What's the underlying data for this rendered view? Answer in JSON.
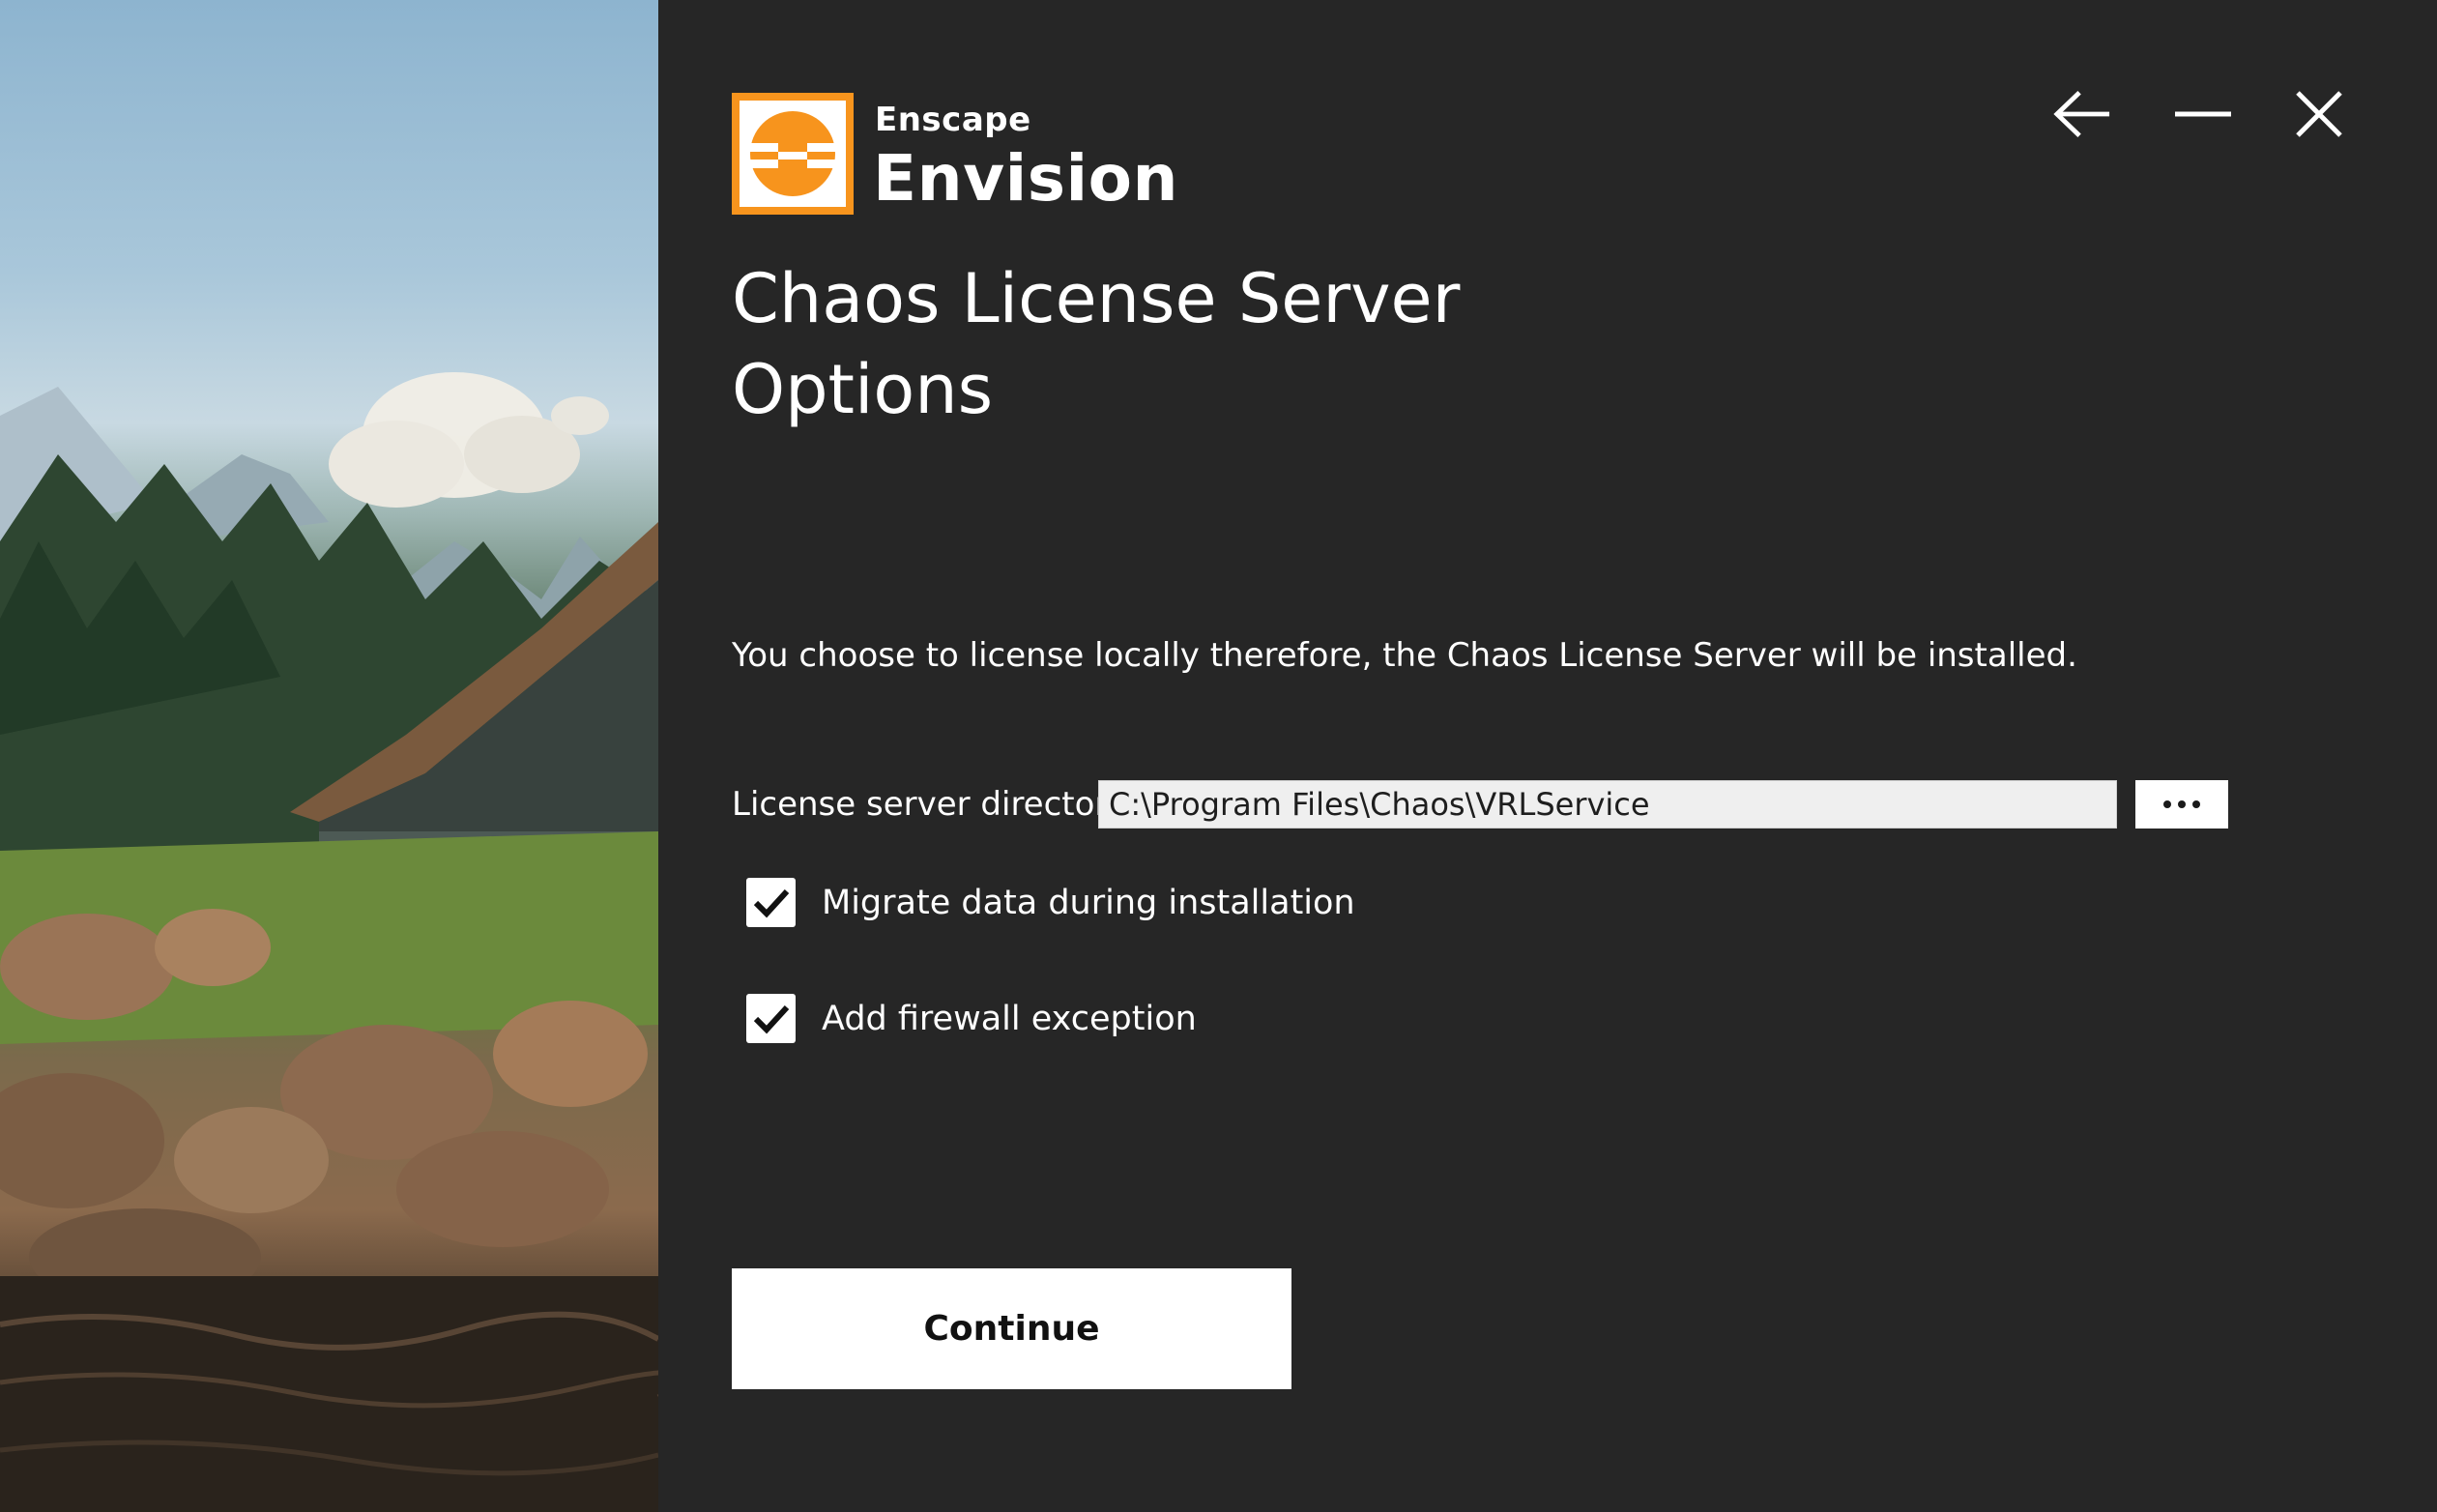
{
  "brand": {
    "small": "Enscape",
    "large": "Envision",
    "accent_color": "#f7941d"
  },
  "window_controls": {
    "back_icon": "arrow-left-icon",
    "minimize_icon": "minimize-icon",
    "close_icon": "close-icon"
  },
  "page": {
    "title_line1": "Chaos License Server",
    "title_line2": "Options",
    "info": "You choose to license locally therefore, the Chaos License Server will be installed."
  },
  "directory": {
    "label": "License server directory",
    "value": "C:\\Program Files\\Chaos\\VRLService",
    "browse_icon": "ellipsis-icon"
  },
  "options": [
    {
      "label": "Migrate data during installation",
      "checked": true
    },
    {
      "label": "Add firewall exception",
      "checked": true
    }
  ],
  "actions": {
    "continue_label": "Continue"
  },
  "colors": {
    "panel_bg": "#262626",
    "button_bg": "#ffffff"
  }
}
